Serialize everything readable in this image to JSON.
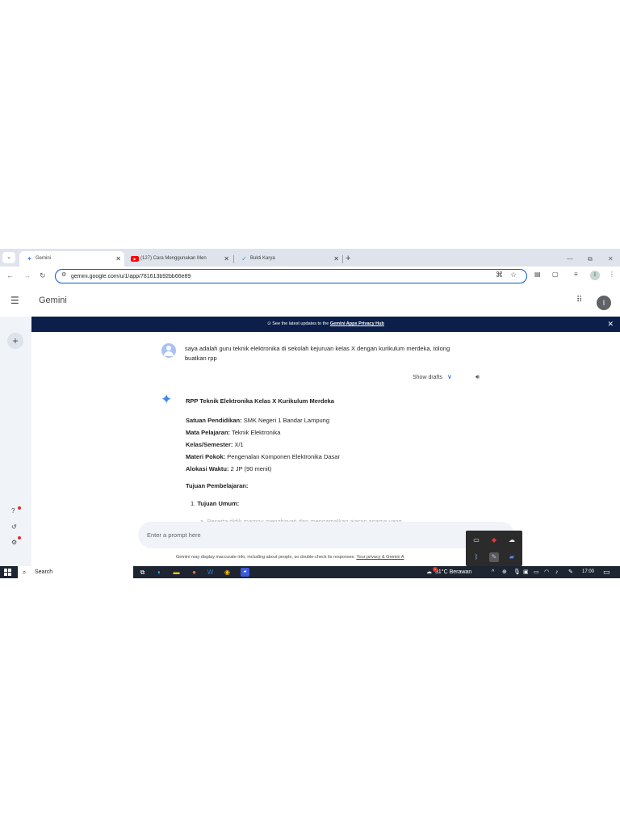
{
  "tabs": [
    {
      "title": "Gemini",
      "icon": "gemini-spark-icon",
      "active": true
    },
    {
      "title": "(127) Cara Menggunakan Men",
      "icon": "youtube-icon",
      "active": false
    },
    {
      "title": "Bukti Karya",
      "icon": "check-logo-icon",
      "active": false
    }
  ],
  "browser": {
    "url": "gemini.google.com/u/1/app/781613b92bb66e89",
    "profile_initial": "I"
  },
  "app": {
    "brand": "Gemini",
    "avatar_initial": "I"
  },
  "banner": {
    "text": "See the latest updates to the ",
    "link": "Gemini Apps Privacy Hub"
  },
  "chat": {
    "user_message": "saya adalah guru teknik elektronika di sekolah kejuruan kelas X dengan kurikulum merdeka, tolong buatkan rpp",
    "show_drafts": "Show drafts",
    "response": {
      "title": "RPP Teknik Elektronika Kelas X Kurikulum Merdeka",
      "rows": [
        {
          "label": "Satuan Pendidikan:",
          "value": " SMK Negeri 1 Bandar Lampung"
        },
        {
          "label": "Mata Pelajaran:",
          "value": " Teknik Elektronika"
        },
        {
          "label": "Kelas/Semester:",
          "value": " X/1"
        },
        {
          "label": "Materi Pokok:",
          "value": " Pengenalan Komponen Elektronika Dasar"
        },
        {
          "label": "Alokasi Waktu:",
          "value": " 2 JP (90 menit)"
        }
      ],
      "section": "Tujuan Pembelajaran:",
      "item_number": "1.",
      "item_label": "Tujuan Umum:",
      "bullet": "a. Peserta didik mampu menghayati dan mengamalkan ajaran agama yang"
    }
  },
  "prompt": {
    "placeholder": "Enter a prompt here"
  },
  "disclaimer": {
    "text": "Gemini may display inaccurate info, including about people, so double-check its responses. ",
    "link": "Your privacy & Gemini A"
  },
  "taskbar": {
    "search_label": "Search",
    "weather": "31°C  Berawan",
    "weather_badge": "1",
    "time": "17:00"
  },
  "colors": {
    "accent": "#0b57d0",
    "banner_bg": "#0b1f4a",
    "sidebar_bg": "#f0f4f9",
    "taskbar_bg": "#1c2531",
    "gemini_blue": "#4285f4"
  }
}
